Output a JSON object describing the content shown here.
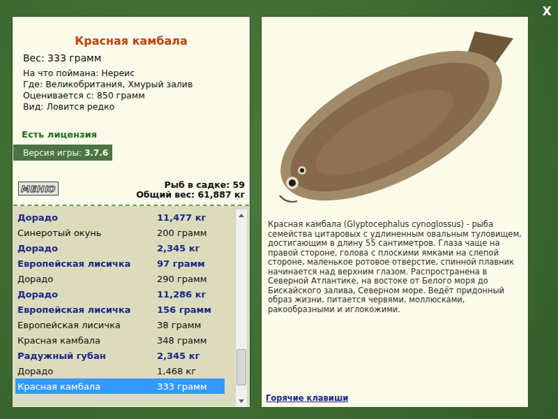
{
  "close": "X",
  "fish": {
    "title": "Красная камбала",
    "weight": "Вес: 333 грамм",
    "details": [
      "На что поймана: Нереис",
      "Где: Великобритания, Хмурый залив",
      "Оценивается с: 850 грамм",
      "Вид: Ловится редко"
    ]
  },
  "license": "Есть лицензия",
  "version": {
    "label": "Версия игры:",
    "value": "3.7.6"
  },
  "menu_button": "МЕНЮ",
  "stats": [
    "Рыб в садке: 59",
    "Общий вес: 61,887 кг"
  ],
  "catch_list": {
    "scrollbar": {
      "level": 0.93
    },
    "rows": [
      {
        "name": "Дорадо",
        "weight": "11,477 кг",
        "trophy": true,
        "selected": false
      },
      {
        "name": "Синеротый окунь",
        "weight": "200 грамм",
        "trophy": false,
        "selected": false
      },
      {
        "name": "Дорадо",
        "weight": "2,345 кг",
        "trophy": true,
        "selected": false
      },
      {
        "name": "Европейская лисичка",
        "weight": "97 грамм",
        "trophy": true,
        "selected": false
      },
      {
        "name": "Дорадо",
        "weight": "290 грамм",
        "trophy": false,
        "selected": false
      },
      {
        "name": "Дорадо",
        "weight": "11,286 кг",
        "trophy": true,
        "selected": false
      },
      {
        "name": "Европейская лисичка",
        "weight": "156 грамм",
        "trophy": true,
        "selected": false
      },
      {
        "name": "Европейская лисичка",
        "weight": "38 грамм",
        "trophy": false,
        "selected": false
      },
      {
        "name": "Красная камбала",
        "weight": "348 грамм",
        "trophy": false,
        "selected": false
      },
      {
        "name": "Радужный губан",
        "weight": "2,345 кг",
        "trophy": true,
        "selected": false
      },
      {
        "name": "Дорадо",
        "weight": "1,468 кг",
        "trophy": false,
        "selected": false
      },
      {
        "name": "Красная камбала",
        "weight": "333 грамм",
        "trophy": false,
        "selected": true
      }
    ]
  },
  "description": "Красная камбала (Glyptocephalus cynoglossus) - рыба семейства цитаровых с удлиненным овальным туловищем, достигающим в длину 55 сантиметров. Глаза чаще на правой стороне, голова с плоскими ямками на слепой стороне, маленькое ротовое отверстие, спинной плавник начинается над верхним глазом. Распространена в Северной Атлантике, на востоке от Белого моря до Бискайского залива, Северном море. Ведёт придонный образ жизни, питается червями, моллюсками, ракообразными и иглокожими.",
  "hotkeys_link": "Горячие клавиши"
}
